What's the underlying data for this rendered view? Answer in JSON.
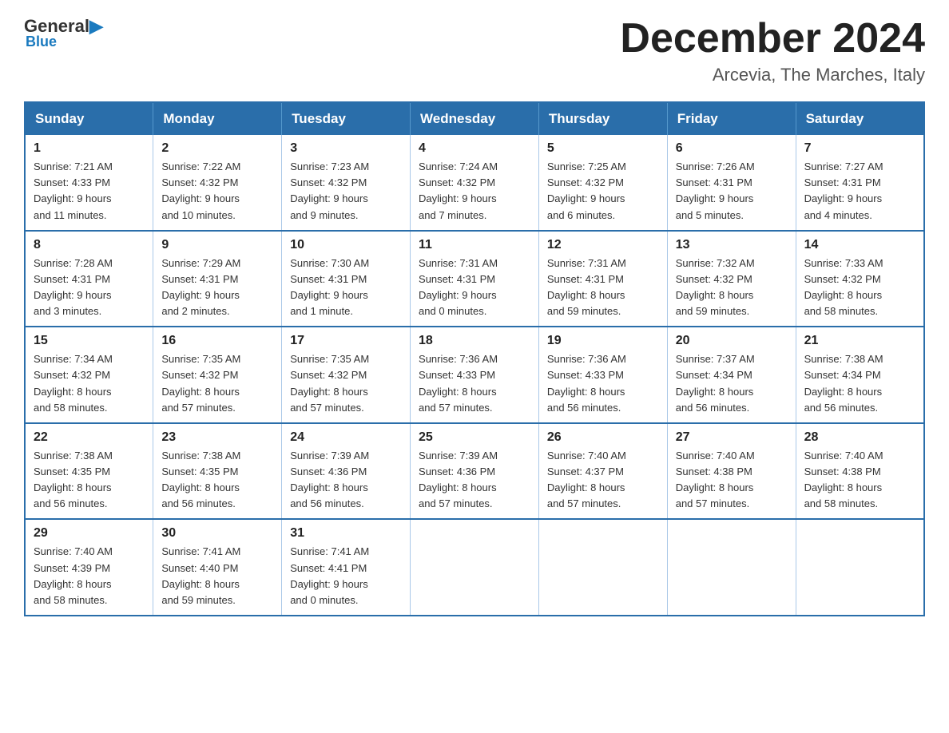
{
  "logo": {
    "general": "General",
    "blue": "Blue"
  },
  "header": {
    "month": "December 2024",
    "location": "Arcevia, The Marches, Italy"
  },
  "days_of_week": [
    "Sunday",
    "Monday",
    "Tuesday",
    "Wednesday",
    "Thursday",
    "Friday",
    "Saturday"
  ],
  "weeks": [
    [
      {
        "day": "1",
        "sunrise": "7:21 AM",
        "sunset": "4:33 PM",
        "daylight": "9 hours and 11 minutes."
      },
      {
        "day": "2",
        "sunrise": "7:22 AM",
        "sunset": "4:32 PM",
        "daylight": "9 hours and 10 minutes."
      },
      {
        "day": "3",
        "sunrise": "7:23 AM",
        "sunset": "4:32 PM",
        "daylight": "9 hours and 9 minutes."
      },
      {
        "day": "4",
        "sunrise": "7:24 AM",
        "sunset": "4:32 PM",
        "daylight": "9 hours and 7 minutes."
      },
      {
        "day": "5",
        "sunrise": "7:25 AM",
        "sunset": "4:32 PM",
        "daylight": "9 hours and 6 minutes."
      },
      {
        "day": "6",
        "sunrise": "7:26 AM",
        "sunset": "4:31 PM",
        "daylight": "9 hours and 5 minutes."
      },
      {
        "day": "7",
        "sunrise": "7:27 AM",
        "sunset": "4:31 PM",
        "daylight": "9 hours and 4 minutes."
      }
    ],
    [
      {
        "day": "8",
        "sunrise": "7:28 AM",
        "sunset": "4:31 PM",
        "daylight": "9 hours and 3 minutes."
      },
      {
        "day": "9",
        "sunrise": "7:29 AM",
        "sunset": "4:31 PM",
        "daylight": "9 hours and 2 minutes."
      },
      {
        "day": "10",
        "sunrise": "7:30 AM",
        "sunset": "4:31 PM",
        "daylight": "9 hours and 1 minute."
      },
      {
        "day": "11",
        "sunrise": "7:31 AM",
        "sunset": "4:31 PM",
        "daylight": "9 hours and 0 minutes."
      },
      {
        "day": "12",
        "sunrise": "7:31 AM",
        "sunset": "4:31 PM",
        "daylight": "8 hours and 59 minutes."
      },
      {
        "day": "13",
        "sunrise": "7:32 AM",
        "sunset": "4:32 PM",
        "daylight": "8 hours and 59 minutes."
      },
      {
        "day": "14",
        "sunrise": "7:33 AM",
        "sunset": "4:32 PM",
        "daylight": "8 hours and 58 minutes."
      }
    ],
    [
      {
        "day": "15",
        "sunrise": "7:34 AM",
        "sunset": "4:32 PM",
        "daylight": "8 hours and 58 minutes."
      },
      {
        "day": "16",
        "sunrise": "7:35 AM",
        "sunset": "4:32 PM",
        "daylight": "8 hours and 57 minutes."
      },
      {
        "day": "17",
        "sunrise": "7:35 AM",
        "sunset": "4:32 PM",
        "daylight": "8 hours and 57 minutes."
      },
      {
        "day": "18",
        "sunrise": "7:36 AM",
        "sunset": "4:33 PM",
        "daylight": "8 hours and 57 minutes."
      },
      {
        "day": "19",
        "sunrise": "7:36 AM",
        "sunset": "4:33 PM",
        "daylight": "8 hours and 56 minutes."
      },
      {
        "day": "20",
        "sunrise": "7:37 AM",
        "sunset": "4:34 PM",
        "daylight": "8 hours and 56 minutes."
      },
      {
        "day": "21",
        "sunrise": "7:38 AM",
        "sunset": "4:34 PM",
        "daylight": "8 hours and 56 minutes."
      }
    ],
    [
      {
        "day": "22",
        "sunrise": "7:38 AM",
        "sunset": "4:35 PM",
        "daylight": "8 hours and 56 minutes."
      },
      {
        "day": "23",
        "sunrise": "7:38 AM",
        "sunset": "4:35 PM",
        "daylight": "8 hours and 56 minutes."
      },
      {
        "day": "24",
        "sunrise": "7:39 AM",
        "sunset": "4:36 PM",
        "daylight": "8 hours and 56 minutes."
      },
      {
        "day": "25",
        "sunrise": "7:39 AM",
        "sunset": "4:36 PM",
        "daylight": "8 hours and 57 minutes."
      },
      {
        "day": "26",
        "sunrise": "7:40 AM",
        "sunset": "4:37 PM",
        "daylight": "8 hours and 57 minutes."
      },
      {
        "day": "27",
        "sunrise": "7:40 AM",
        "sunset": "4:38 PM",
        "daylight": "8 hours and 57 minutes."
      },
      {
        "day": "28",
        "sunrise": "7:40 AM",
        "sunset": "4:38 PM",
        "daylight": "8 hours and 58 minutes."
      }
    ],
    [
      {
        "day": "29",
        "sunrise": "7:40 AM",
        "sunset": "4:39 PM",
        "daylight": "8 hours and 58 minutes."
      },
      {
        "day": "30",
        "sunrise": "7:41 AM",
        "sunset": "4:40 PM",
        "daylight": "8 hours and 59 minutes."
      },
      {
        "day": "31",
        "sunrise": "7:41 AM",
        "sunset": "4:41 PM",
        "daylight": "9 hours and 0 minutes."
      },
      null,
      null,
      null,
      null
    ]
  ],
  "labels": {
    "sunrise": "Sunrise:",
    "sunset": "Sunset:",
    "daylight": "Daylight:"
  }
}
